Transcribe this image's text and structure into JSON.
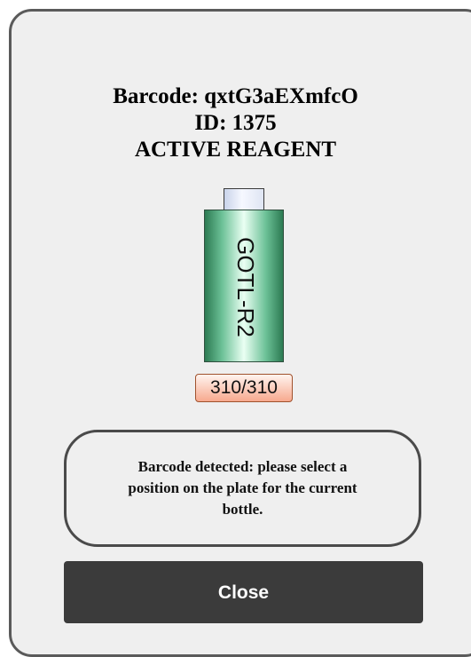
{
  "dialog": {
    "barcode_line": "Barcode: qxtG3aEXmfcO",
    "id_line": "ID: 1375",
    "status_line": "ACTIVE REAGENT"
  },
  "bottle": {
    "label": "GOTL-R2",
    "count": "310/310",
    "icon": "reagent-bottle-icon",
    "body_color": "#4aa574",
    "cap_color": "#dbe2f2",
    "badge_color": "#f7a98e"
  },
  "message": {
    "text": "Barcode detected: please select a position on the plate for the current bottle."
  },
  "actions": {
    "close_label": "Close"
  }
}
